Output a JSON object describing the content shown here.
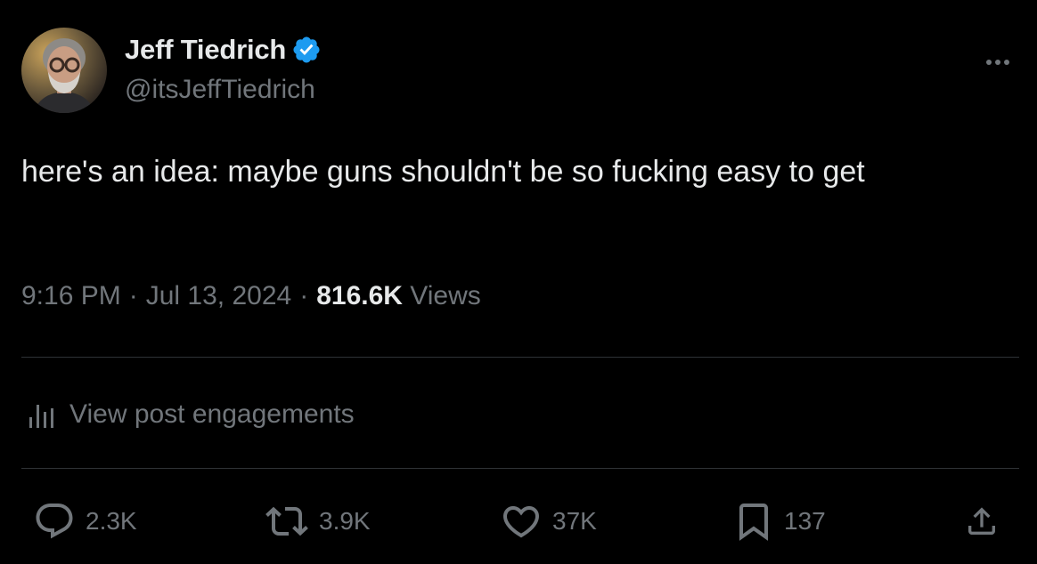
{
  "author": {
    "display_name": "Jeff Tiedrich",
    "handle": "@itsJeffTiedrich",
    "verified": true
  },
  "post": {
    "text": "here's an idea: maybe guns shouldn't be so fucking easy to get",
    "time": "9:16 PM",
    "date": "Jul 13, 2024",
    "separator": "·",
    "views_count": "816.6K",
    "views_label": "Views"
  },
  "engagements_link": "View post engagements",
  "actions": {
    "replies": "2.3K",
    "reposts": "3.9K",
    "likes": "37K",
    "bookmarks": "137"
  },
  "icons": {
    "verified": "verified-badge-icon",
    "more": "more-options-icon",
    "engagements": "bar-chart-icon",
    "reply": "reply-icon",
    "repost": "repost-icon",
    "like": "heart-icon",
    "bookmark": "bookmark-icon",
    "share": "share-icon"
  },
  "colors": {
    "background": "#000000",
    "primary_text": "#e7e9ea",
    "secondary_text": "#71767b",
    "divider": "#2f3336",
    "verified_blue": "#1d9bf0"
  }
}
